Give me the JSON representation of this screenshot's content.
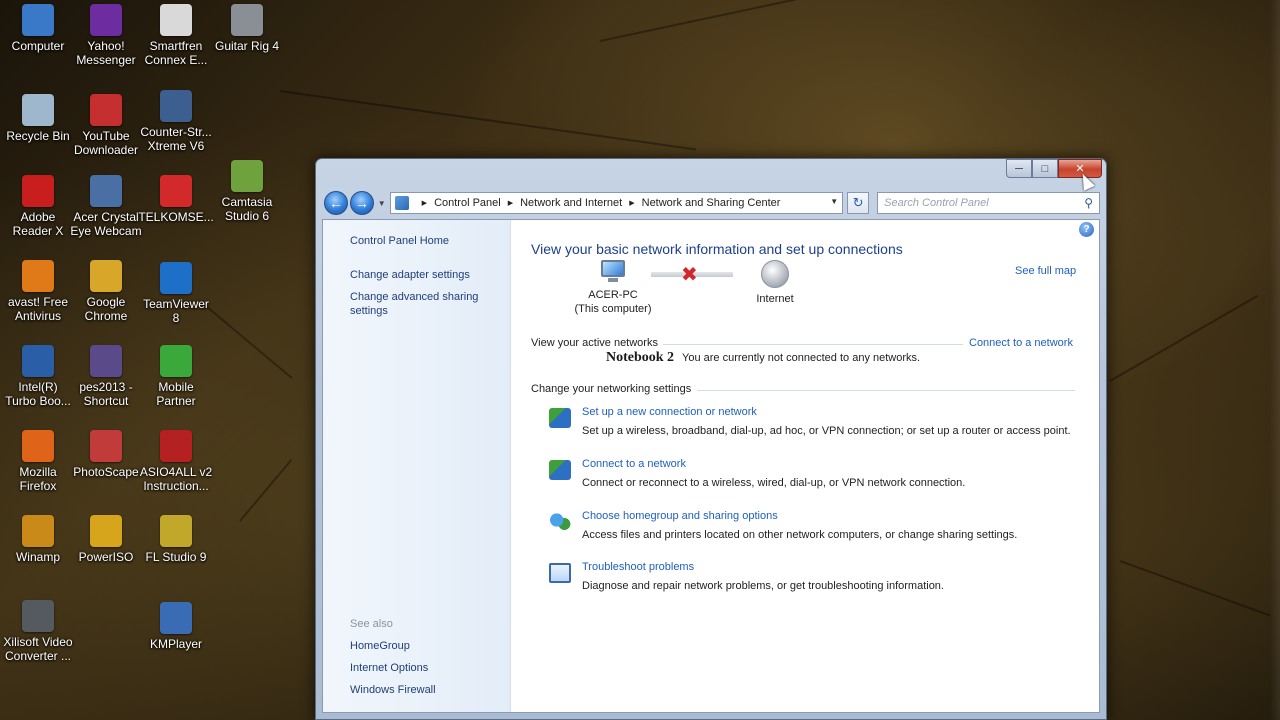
{
  "desktop": {
    "icons": [
      {
        "label": "Computer",
        "icon": "computer-icon",
        "color": "#3a78c8"
      },
      {
        "label": "Yahoo!\nMessenger",
        "icon": "yahoo-messenger-icon",
        "color": "#6d2ca0"
      },
      {
        "label": "Smartfren\nConnex E...",
        "icon": "smartfren-icon",
        "color": "#d9d9d9"
      },
      {
        "label": "Guitar Rig 4",
        "icon": "guitar-rig-icon",
        "color": "#8a8f96"
      },
      {
        "label": "Recycle Bin",
        "icon": "recycle-bin-icon",
        "color": "#9fb7cc"
      },
      {
        "label": "YouTube\nDownloader",
        "icon": "youtube-downloader-icon",
        "color": "#c62f2f"
      },
      {
        "label": "Counter-Str...\nXtreme V6",
        "icon": "counter-strike-icon",
        "color": "#3c5f8f"
      },
      {
        "label": "Camtasia\nStudio 6",
        "icon": "camtasia-icon",
        "color": "#6fa23c"
      },
      {
        "label": "Adobe\nReader X",
        "icon": "adobe-reader-icon",
        "color": "#c81e1e"
      },
      {
        "label": "Acer Crystal\nEye Webcam",
        "icon": "webcam-icon",
        "color": "#4a6fa5"
      },
      {
        "label": "TELKOMSE...",
        "icon": "telkomsel-icon",
        "color": "#d22a2a"
      },
      {
        "label": "avast! Free\nAntivirus",
        "icon": "avast-icon",
        "color": "#e07a18"
      },
      {
        "label": "Google\nChrome",
        "icon": "chrome-icon",
        "color": "#d8a72a"
      },
      {
        "label": "TeamViewer\n8",
        "icon": "teamviewer-icon",
        "color": "#1e6fc8"
      },
      {
        "label": "Intel(R)\nTurbo Boo...",
        "icon": "intel-turbo-icon",
        "color": "#2a5fa8"
      },
      {
        "label": "pes2013 -\nShortcut",
        "icon": "pes2013-icon",
        "color": "#5a4a8a"
      },
      {
        "label": "Mobile\nPartner",
        "icon": "mobile-partner-icon",
        "color": "#3aa83a"
      },
      {
        "label": "Mozilla\nFirefox",
        "icon": "firefox-icon",
        "color": "#e0631a"
      },
      {
        "label": "PhotoScape",
        "icon": "photoscape-icon",
        "color": "#c23b3b"
      },
      {
        "label": "ASIO4ALL v2\nInstruction...",
        "icon": "pdf-icon",
        "color": "#b52020"
      },
      {
        "label": "Winamp",
        "icon": "winamp-icon",
        "color": "#c98a1a"
      },
      {
        "label": "PowerISO",
        "icon": "poweriso-icon",
        "color": "#d6a51c"
      },
      {
        "label": "FL Studio 9",
        "icon": "fl-studio-icon",
        "color": "#c2a82a"
      },
      {
        "label": "Xilisoft Video\nConverter ...",
        "icon": "xilisoft-icon",
        "color": "#555a60"
      },
      {
        "label": "KMPlayer",
        "icon": "kmplayer-icon",
        "color": "#3a6cb5"
      }
    ]
  },
  "window": {
    "address": {
      "crumbs": [
        "Control Panel",
        "Network and Internet",
        "Network and Sharing Center"
      ]
    },
    "search": {
      "placeholder": "Search Control Panel"
    },
    "left": {
      "home": "Control Panel Home",
      "links": [
        "Change adapter settings",
        "Change advanced sharing settings"
      ],
      "see_also_title": "See also",
      "see_also": [
        "HomeGroup",
        "Internet Options",
        "Windows Firewall"
      ]
    },
    "main": {
      "heading": "View your basic network information and set up connections",
      "see_full_map": "See full map",
      "computer_name": "ACER-PC",
      "computer_sub": "(This computer)",
      "internet": "Internet",
      "active_networks": "View your active networks",
      "connect_link": "Connect to a network",
      "notebook": "Notebook 2",
      "not_connected": "You are currently not connected to any networks.",
      "change_settings": "Change your networking settings",
      "tasks": [
        {
          "title": "Set up a new connection or network",
          "desc": "Set up a wireless, broadband, dial-up, ad hoc, or VPN connection; or set up a router or access point.",
          "icon": "new-connection-icon"
        },
        {
          "title": "Connect to a network",
          "desc": "Connect or reconnect to a wireless, wired, dial-up, or VPN network connection.",
          "icon": "connect-network-icon"
        },
        {
          "title": "Choose homegroup and sharing options",
          "desc": "Access files and printers located on other network computers, or change sharing settings.",
          "icon": "homegroup-icon"
        },
        {
          "title": "Troubleshoot problems",
          "desc": "Diagnose and repair network problems, or get troubleshooting information.",
          "icon": "troubleshoot-icon"
        }
      ]
    }
  }
}
